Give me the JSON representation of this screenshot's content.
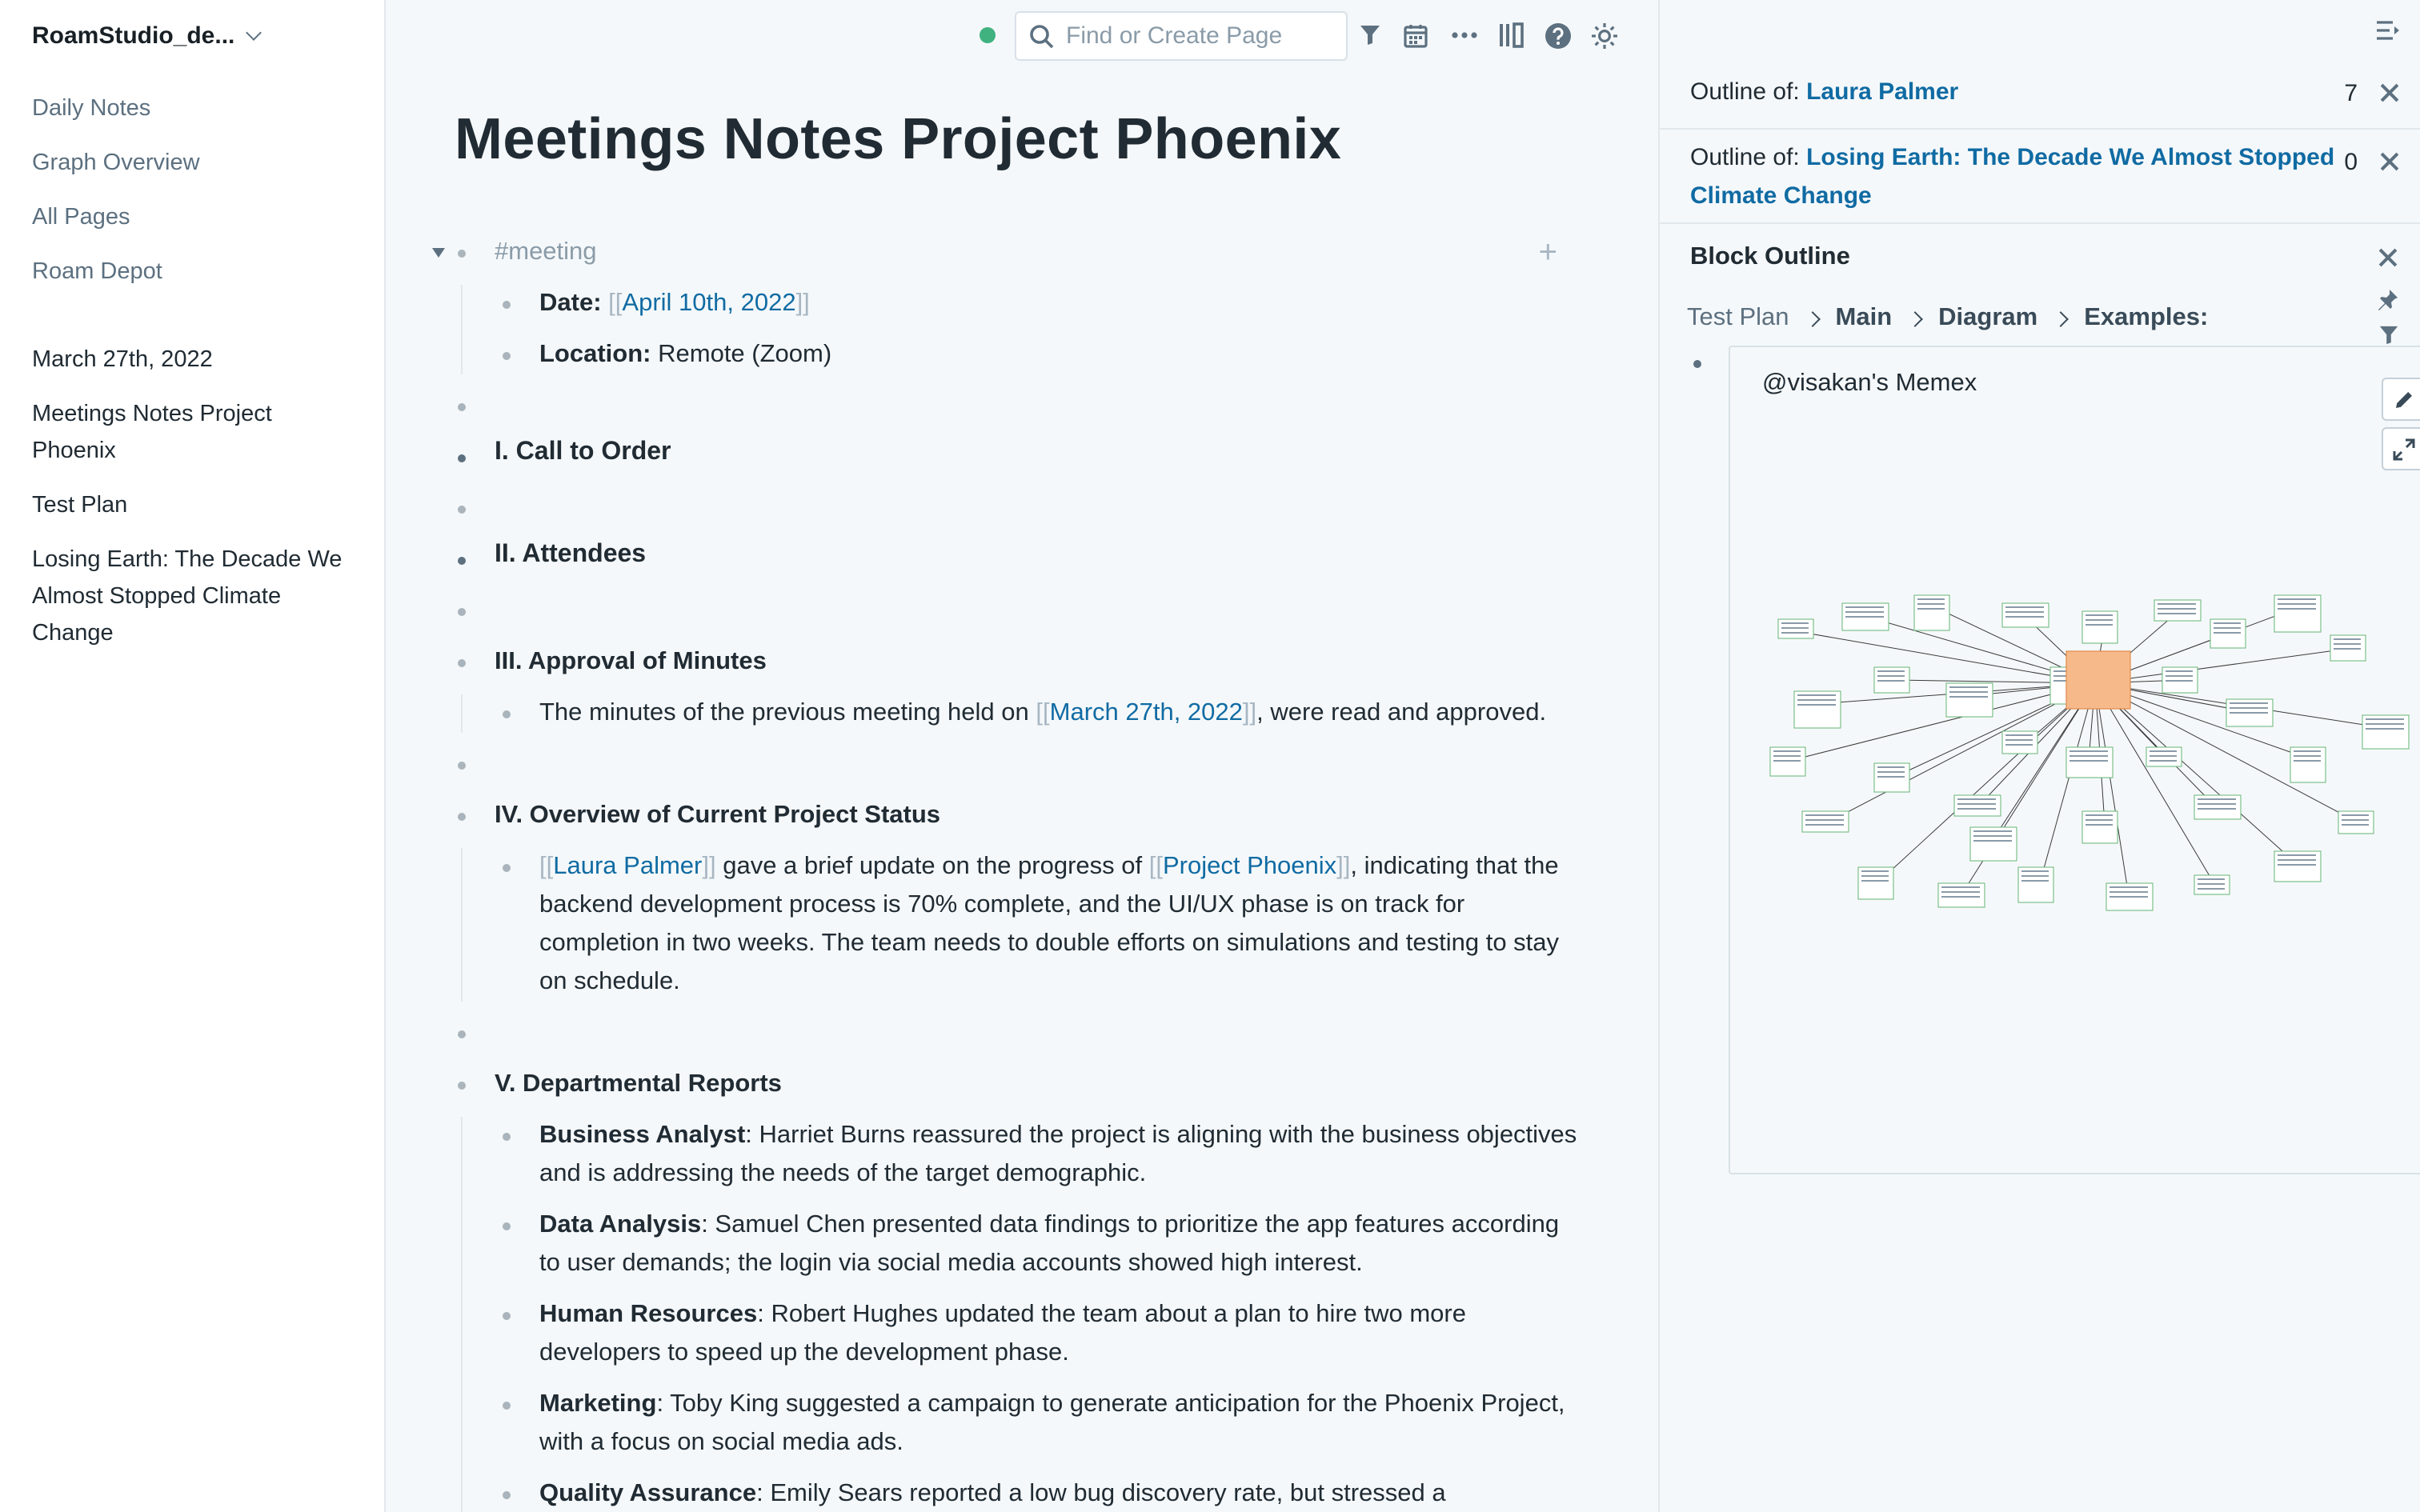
{
  "sidebar": {
    "graph_name": "RoamStudio_de...",
    "nav": [
      "Daily Notes",
      "Graph Overview",
      "All Pages",
      "Roam Depot"
    ],
    "shortcuts": [
      "March 27th, 2022",
      "Meetings Notes Project Phoenix",
      "Test Plan",
      "Losing Earth: The Decade We Almost Stopped Climate Change"
    ]
  },
  "topbar": {
    "search_placeholder": "Find or Create Page",
    "status_color": "#3fb27f",
    "icons": [
      "filter-icon",
      "calendar-icon",
      "more-icon",
      "sidebar-toggle-icon",
      "help-icon",
      "settings-icon"
    ]
  },
  "page": {
    "title": "Meetings Notes Project Phoenix",
    "meeting_tag": "#meeting",
    "date_label": "Date:",
    "date_link": "April 10th, 2022",
    "location_label": "Location:",
    "location_value": "Remote (Zoom)",
    "h1": "I. Call to Order",
    "h2": "II. Attendees",
    "h3": "III. Approval of Minutes",
    "minutes_pre": "The minutes of the previous meeting held on ",
    "minutes_link": "March 27th, 2022",
    "minutes_post": ", were read and approved.",
    "h4": "IV. Overview of Current Project Status",
    "status_link1": "Laura Palmer",
    "status_mid": " gave a brief update on the progress of ",
    "status_link2": "Project Phoenix",
    "status_post": ", indicating that the backend development process is 70% complete, and the UI/UX phase is on track for completion in two weeks. The team needs to double efforts on simulations and testing to stay on schedule.",
    "h5": "V. Departmental Reports",
    "reports": [
      {
        "role": "Business Analyst",
        "text": ": Harriet Burns reassured the project is aligning with the business objectives and is addressing the needs of the target demographic."
      },
      {
        "role": "Data Analysis",
        "text": ": Samuel Chen presented data findings to prioritize the app features according to user demands; the login via social media accounts showed high interest."
      },
      {
        "role": "Human Resources",
        "text": ": Robert Hughes updated the team about a plan to hire two more developers to speed up the development phase."
      },
      {
        "role": "Marketing",
        "text": ": Toby King suggested a campaign to generate anticipation for the Phoenix Project, with a focus on social media ads."
      },
      {
        "role": "Quality Assurance",
        "text": ": Emily Sears reported a low bug discovery rate, but stressed a"
      }
    ]
  },
  "right_panel": {
    "outline_prefix": "Outline of: ",
    "outline1_link": "Laura Palmer",
    "outline1_count": "7",
    "outline2_link": "Losing Earth: The Decade We Almost Stopped Climate Change",
    "outline2_count": "0",
    "block_outline_title": "Block Outline",
    "breadcrumbs": [
      "Test Plan",
      "Main",
      "Diagram",
      "Examples:"
    ],
    "embed_title": "@visakan's Memex"
  }
}
